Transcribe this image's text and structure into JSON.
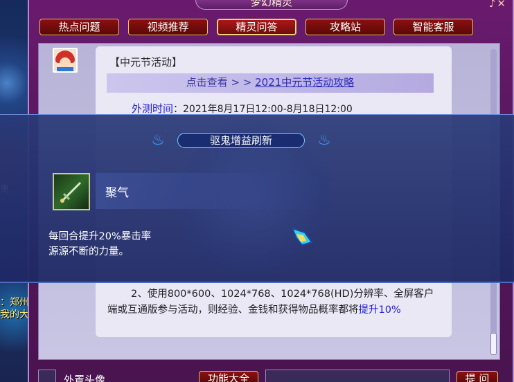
{
  "window": {
    "title": "梦幻精灵",
    "close_glyphs": "♪✕"
  },
  "tabs": [
    {
      "label": "热点问题",
      "active": false
    },
    {
      "label": "视频推荐",
      "active": false
    },
    {
      "label": "精灵问答",
      "active": true
    },
    {
      "label": "攻略站",
      "active": false
    },
    {
      "label": "智能客服",
      "active": false
    }
  ],
  "message": {
    "title": "【中元节活动】",
    "link_prefix": "点击查看 > > ",
    "link_text": "2021中元节活动攻略",
    "time_label": "外测时间",
    "time_value": "：2021年8月17日12:00-8月18日12:00",
    "body_line": "2、使用800*600、1024*768、1024*768(HD)分辨率、全屏客户端或互通版参与活动，则经验、金钱和获得物品概率都将",
    "body_highlight": "提升10%"
  },
  "overlay": {
    "title": "驱鬼增益刷新",
    "skill_name": "聚气",
    "skill_desc_line1": "每回合提升20%暴击率",
    "skill_desc_line2": "源源不断的力量。"
  },
  "game_side": {
    "label": "鬼",
    "text_line1": "：郑州",
    "text_line2": "我的大"
  },
  "bottom": {
    "checkbox_label": "外置头像",
    "func_button": "功能大全",
    "ask_button": "提 问",
    "input_value": ""
  },
  "colors": {
    "window_purple": "#5d1f66",
    "tab_red": "#8c1010",
    "link_blue": "#2a2ac0",
    "highlight_blue": "#1c1cd0",
    "overlay_blue": "#2a3a78"
  }
}
